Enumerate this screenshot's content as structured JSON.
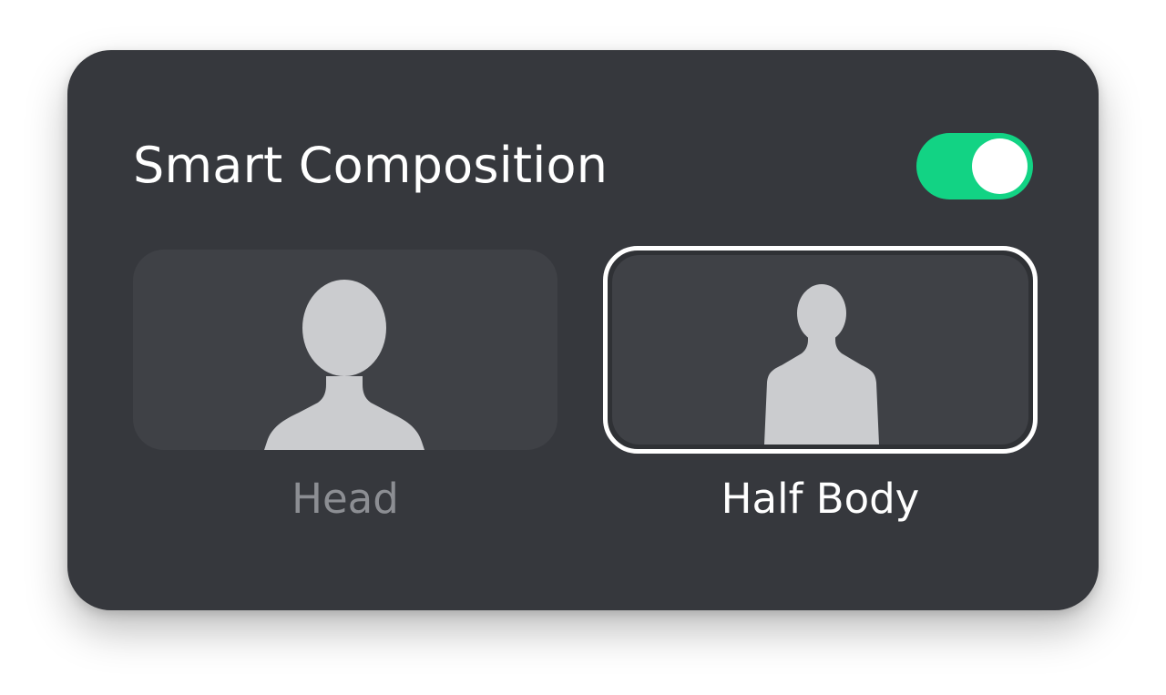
{
  "panel": {
    "title": "Smart Composition",
    "toggle": {
      "state": "on",
      "color": "#12d384"
    }
  },
  "options": [
    {
      "label": "Head",
      "icon": "head-silhouette-icon",
      "selected": false
    },
    {
      "label": "Half Body",
      "icon": "half-body-silhouette-icon",
      "selected": true
    }
  ],
  "colors": {
    "panel_background": "#36383d",
    "tile_background": "#3f4146",
    "selected_border": "#ffffff",
    "unselected_label": "#8c8e93",
    "silhouette": "#cbcccf"
  }
}
